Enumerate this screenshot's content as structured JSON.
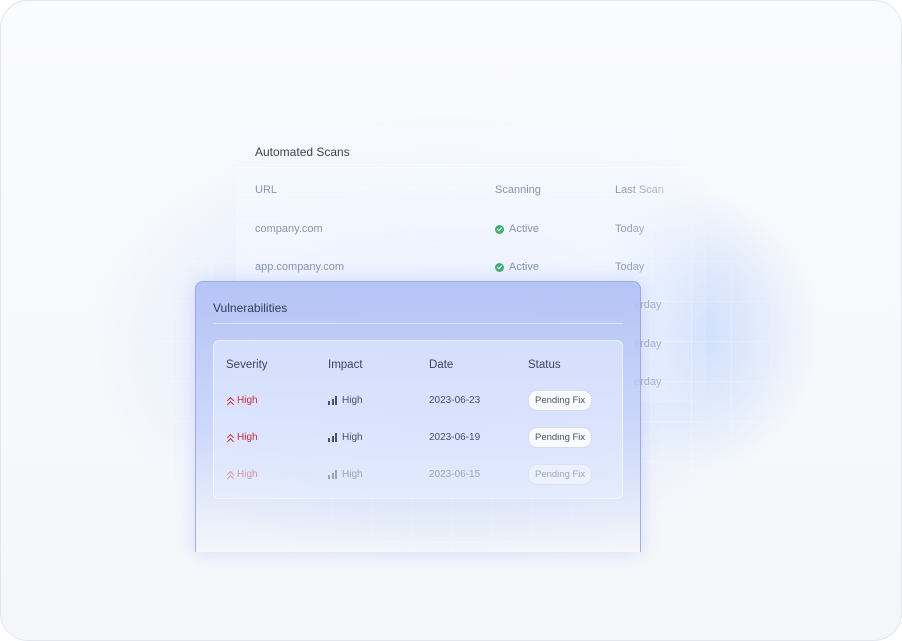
{
  "automated_scans": {
    "title": "Automated Scans",
    "columns": [
      "URL",
      "Scanning",
      "Last Scan"
    ],
    "rows": [
      {
        "url": "company.com",
        "scanning": "Active",
        "last_scan": "Today"
      },
      {
        "url": "app.company.com",
        "scanning": "Active",
        "last_scan": "Today"
      },
      {
        "last_scan": "erday"
      },
      {
        "last_scan": "erday"
      },
      {
        "last_scan": "erday"
      }
    ]
  },
  "vulnerabilities": {
    "title": "Vulnerabilities",
    "columns": [
      "Severity",
      "Impact",
      "Date",
      "Status"
    ],
    "rows": [
      {
        "severity": "High",
        "impact": "High",
        "date": "2023-06-23",
        "status": "Pending Fix"
      },
      {
        "severity": "High",
        "impact": "High",
        "date": "2023-06-19",
        "status": "Pending Fix"
      },
      {
        "severity": "High",
        "impact": "High",
        "date": "2023-06-15",
        "status": "Pending Fix"
      }
    ]
  },
  "colors": {
    "severity_high": "#d9283c",
    "active_status": "#3fae6f",
    "card_accent": "#b2c0f5"
  },
  "icons": {
    "active": "check-circle-icon",
    "severity": "chevrons-up-icon",
    "impact": "signal-bars-icon"
  }
}
